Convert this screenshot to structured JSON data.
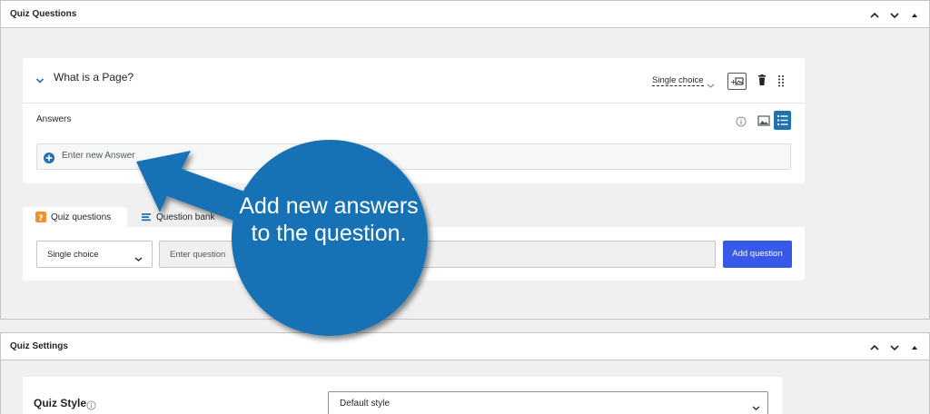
{
  "quiz_questions_box": {
    "title": "Quiz Questions",
    "question": {
      "title": "What is a Page?",
      "type": "Single choice",
      "answers_label": "Answers",
      "answer_placeholder": "Enter new Answer"
    },
    "tabs": [
      {
        "label": "Quiz questions"
      },
      {
        "label": "Question bank"
      }
    ],
    "add": {
      "type_value": "Single choice",
      "question_placeholder": "Enter question",
      "button_label": "Add question"
    }
  },
  "quiz_settings_box": {
    "title": "Quiz Settings",
    "style_label": "Quiz Style",
    "style_value": "Default style"
  },
  "callout": {
    "text": "Add new answers to the question.",
    "color": "#1772b4"
  },
  "colors": {
    "primary_button": "#3858e9",
    "active_toggle": "#2271b1",
    "tab_icon_orange": "#f0912d"
  }
}
